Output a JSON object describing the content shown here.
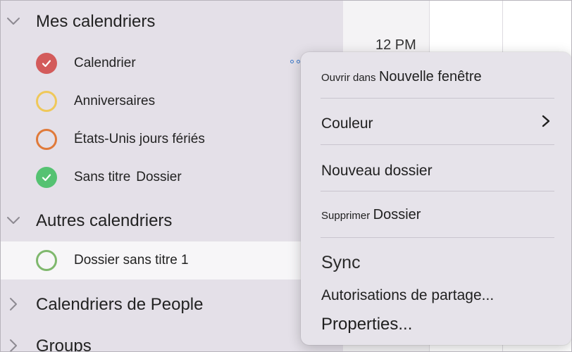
{
  "sidebar": {
    "sections": [
      {
        "title": "Mes calendriers",
        "expanded": true
      },
      {
        "title": "Autres calendriers",
        "expanded": true
      },
      {
        "title": "Calendriers de People",
        "expanded": false
      },
      {
        "title": "Groups",
        "expanded": false
      }
    ],
    "my_calendars": [
      {
        "label": "Calendrier",
        "color": "#d35b5b",
        "checked": true,
        "filled": true
      },
      {
        "label": "Anniversaires",
        "color": "#efc85a",
        "checked": false,
        "filled": false
      },
      {
        "label": "États-Unis jours fériés",
        "color": "#e07a3a",
        "checked": false,
        "filled": false
      },
      {
        "label_part1": "Sans titre",
        "label_part2": "Dossier",
        "color": "#55c272",
        "checked": true,
        "filled": true
      }
    ],
    "other_calendars": [
      {
        "label": "Dossier sans titre 1",
        "color": "#7fb86d",
        "checked": false,
        "filled": false,
        "selected": true
      }
    ]
  },
  "grid": {
    "time_label": "12 PM"
  },
  "context_menu": {
    "open_in_prefix": "Ouvrir dans",
    "open_in_target": "Nouvelle fenêtre",
    "color": "Couleur",
    "new_folder": "Nouveau dossier",
    "delete_prefix": "Supprimer",
    "delete_target": "Dossier",
    "sync": "Sync",
    "sharing_permissions": "Autorisations de partage...",
    "properties": "Properties..."
  },
  "icons": {
    "expanded_chevron": "chevron-down-icon",
    "collapsed_chevron": "chevron-right-icon",
    "submenu_chevron": "chevron-right-icon",
    "checkmark": "checkmark-icon",
    "more": "more-options-icon"
  }
}
